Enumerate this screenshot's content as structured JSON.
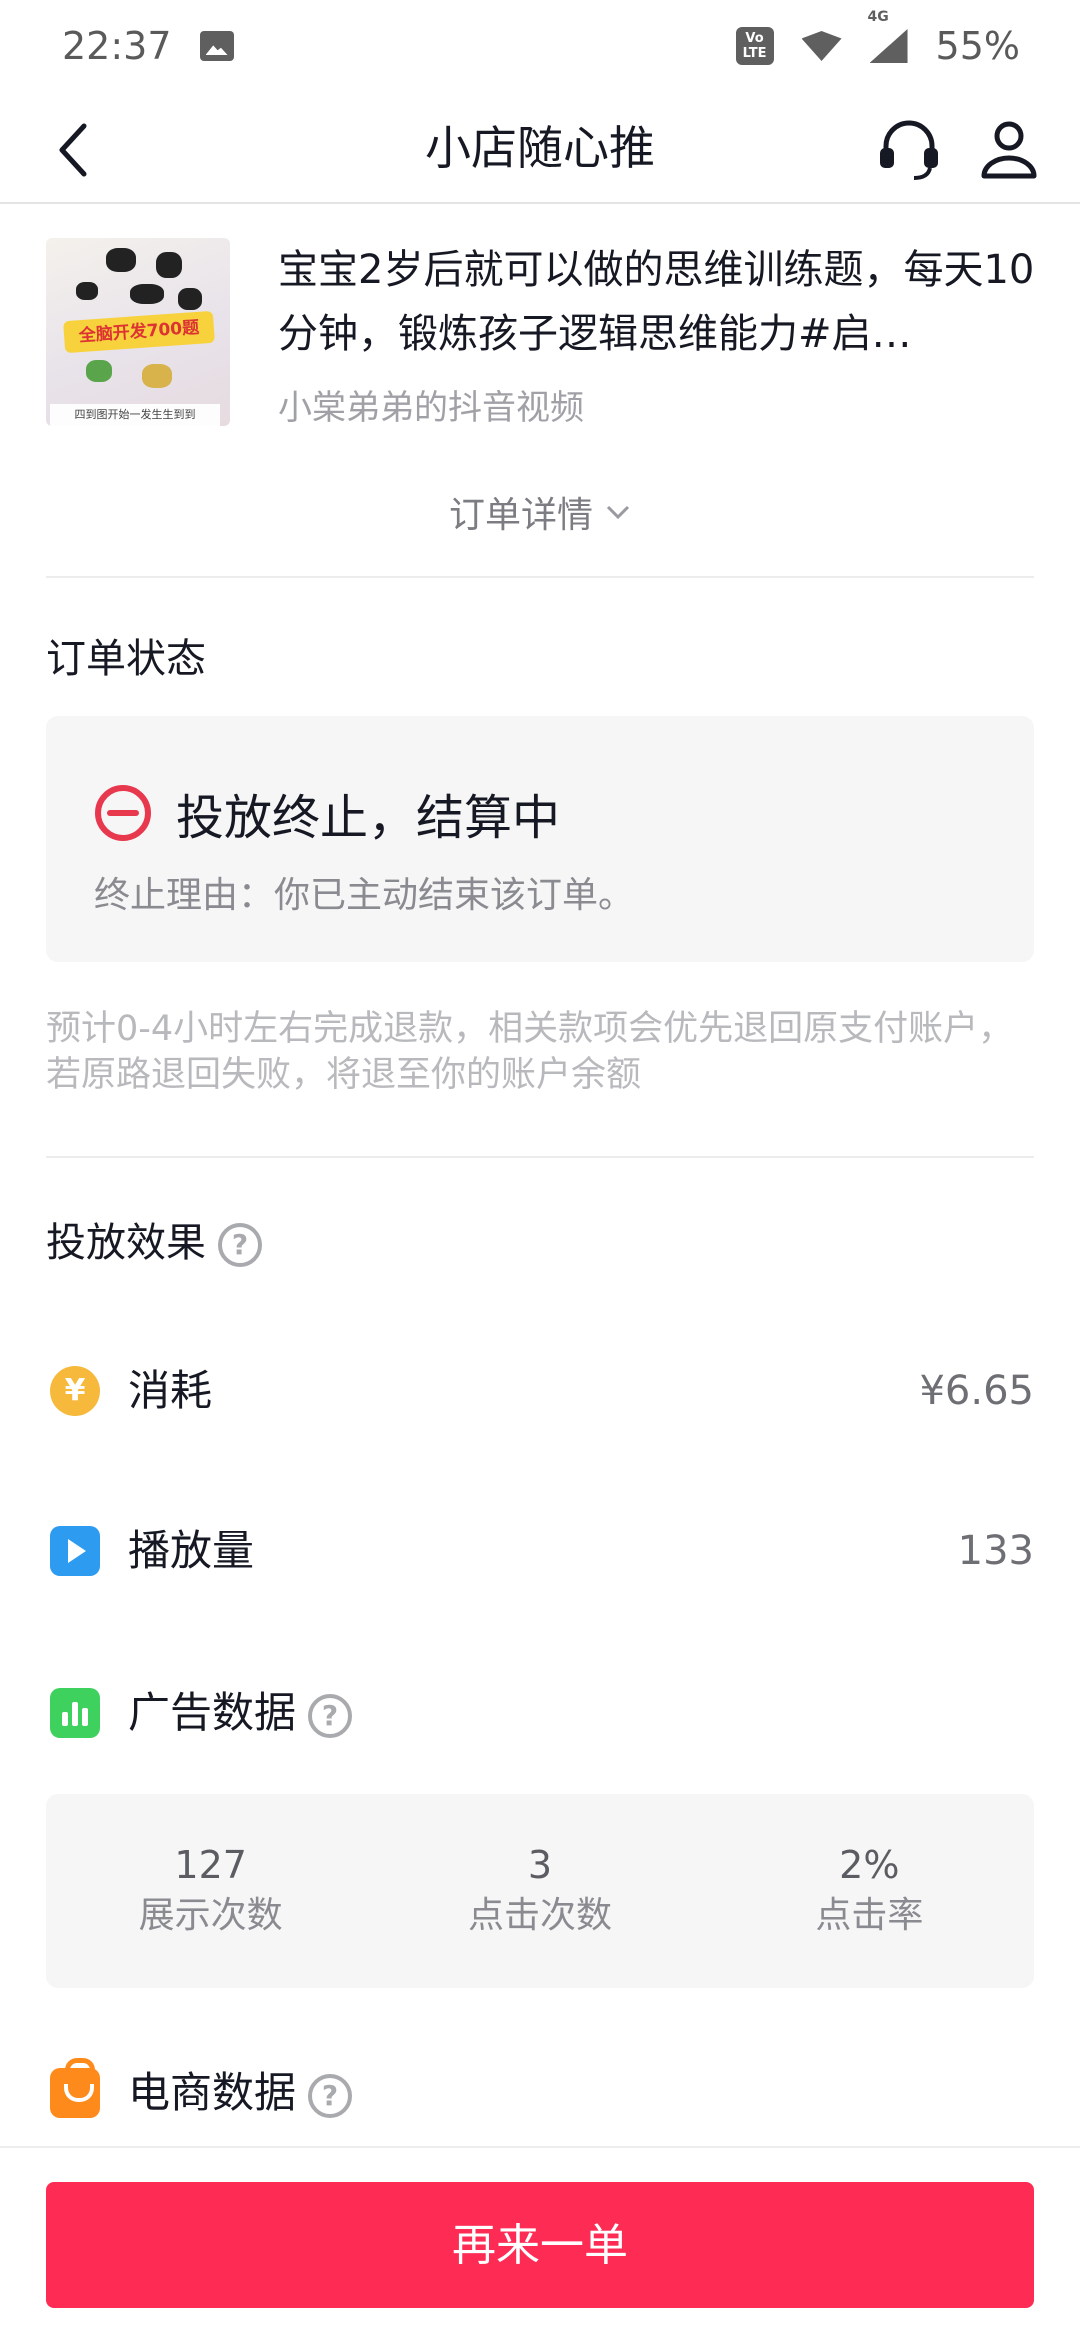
{
  "status_bar": {
    "time": "22:37",
    "volte": "Vo LTE",
    "network": "4G",
    "battery": "55%"
  },
  "header": {
    "title": "小店随心推"
  },
  "video": {
    "title": "宝宝2岁后就可以做的思维训练题，每天10分钟，锻炼孩子逻辑思维能力#启…",
    "author": "小棠弟弟的抖音视频",
    "thumbnail_badge": "全脑开发700题",
    "thumbnail_caption": "四到图开始一发生生到到"
  },
  "order_detail_label": "订单详情",
  "order_status": {
    "section_title": "订单状态",
    "main": "投放终止，结算中",
    "reason": "终止理由：你已主动结束该订单。"
  },
  "refund_note": "预计0-4小时左右完成退款，相关款项会优先退回原支付账户，若原路退回失败，将退至你的账户余额",
  "effect": {
    "section_title": "投放效果",
    "help": "?",
    "consume": {
      "icon": "yen-coin-icon",
      "symbol": "¥",
      "label": "消耗",
      "value": "¥6.65"
    },
    "plays": {
      "icon": "play-icon",
      "label": "播放量",
      "value": "133"
    },
    "ad_data": {
      "icon": "bar-chart-icon",
      "label": "广告数据",
      "stats": [
        {
          "value": "127",
          "label": "展示次数"
        },
        {
          "value": "3",
          "label": "点击次数"
        },
        {
          "value": "2%",
          "label": "点击率"
        }
      ]
    },
    "ecommerce": {
      "icon": "shopping-bag-icon",
      "label": "电商数据"
    }
  },
  "bottom": {
    "button_label": "再来一单"
  },
  "colors": {
    "brand": "#fe2c55",
    "stop_red": "#e8384e",
    "coin": "#f6b93b",
    "play": "#2d9bf0",
    "bars": "#3fd15d",
    "bag": "#ff8a1c"
  }
}
